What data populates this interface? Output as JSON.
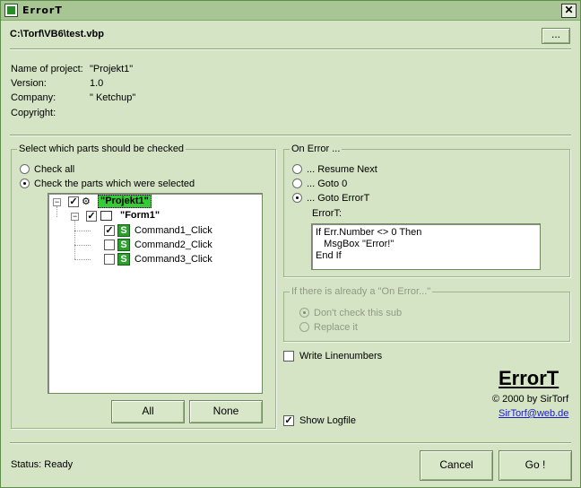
{
  "window": {
    "title": "ErrorT",
    "close_label": "✕"
  },
  "header": {
    "project_path": "C:\\Torf\\VB6\\test.vbp",
    "browse_label": "..."
  },
  "project_info": {
    "name_label": "Name of project:",
    "name_value": "\"Projekt1\"",
    "version_label": "Version:",
    "version_value": "1.0",
    "company_label": "Company:",
    "company_value": "\" Ketchup\"",
    "copyright_label": "Copyright:",
    "copyright_value": ""
  },
  "check_group": {
    "title": "Select which parts should be checked",
    "check_all_label": "Check all",
    "check_selected_label": "Check the parts which were selected",
    "selected_option": "selected",
    "all_button": "All",
    "none_button": "None"
  },
  "tree": {
    "project": {
      "label": "\"Projekt1\"",
      "checked": true
    },
    "form": {
      "label": "\"Form1\"",
      "checked": true
    },
    "subs": [
      {
        "label": "Command1_Click",
        "checked": true
      },
      {
        "label": "Command2_Click",
        "checked": false
      },
      {
        "label": "Command3_Click",
        "checked": false
      }
    ]
  },
  "on_error_group": {
    "title": "On Error ...",
    "options": [
      "... Resume Next",
      "... Goto 0",
      "... Goto ErrorT"
    ],
    "selected_index": 2,
    "errort_label": "ErrorT:",
    "code_lines": [
      "If Err.Number <> 0 Then",
      "   MsgBox \"Error!\"",
      "End If"
    ]
  },
  "existing_group": {
    "title": "If there is already a \"On Error...\"",
    "options": [
      "Don't check this sub",
      "Replace it"
    ],
    "selected_index": 0,
    "disabled": true
  },
  "options": {
    "write_linenumbers_label": "Write Linenumbers",
    "write_linenumbers_checked": false,
    "show_logfile_label": "Show Logfile",
    "show_logfile_checked": true
  },
  "branding": {
    "logo": "ErrorT",
    "copyright": "© 2000 by SirTorf",
    "email": "SirTorf@web.de"
  },
  "footer": {
    "status": "Status: Ready",
    "cancel_label": "Cancel",
    "go_label": "Go !"
  },
  "colors": {
    "window_bg": "#d4e4c4",
    "titlebar": "#a8c594",
    "tree_highlight": "#33cc33",
    "link": "#1a1ad4"
  }
}
